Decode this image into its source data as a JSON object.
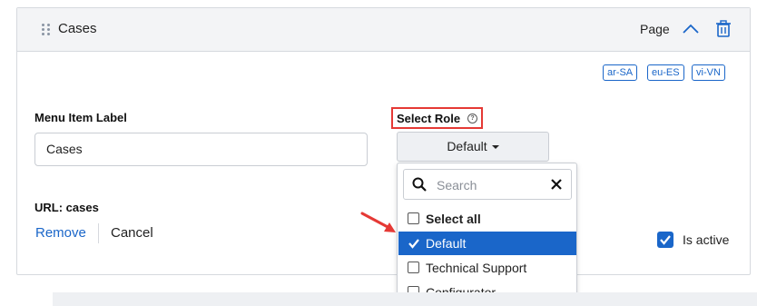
{
  "panel": {
    "title": "Cases",
    "type_label": "Page"
  },
  "languages": [
    "ar-SA",
    "eu-ES",
    "vi-VN"
  ],
  "form": {
    "menu_item_label": "Menu Item Label",
    "menu_item_value": "Cases",
    "select_role_label": "Select Role",
    "help_glyph": "?",
    "selected_role": "Default",
    "url_label": "URL: cases",
    "remove_label": "Remove",
    "cancel_label": "Cancel",
    "is_active_label": "Is active",
    "is_active": true
  },
  "dropdown": {
    "search_placeholder": "Search",
    "options": [
      {
        "label": "Select all",
        "checked": false
      },
      {
        "label": "Default",
        "checked": true
      },
      {
        "label": "Technical Support",
        "checked": false
      },
      {
        "label": "Configurator",
        "checked": false
      }
    ]
  },
  "colors": {
    "accent": "#1a66c9",
    "highlight_border": "#e53935",
    "annotation_arrow": "#e53935"
  }
}
